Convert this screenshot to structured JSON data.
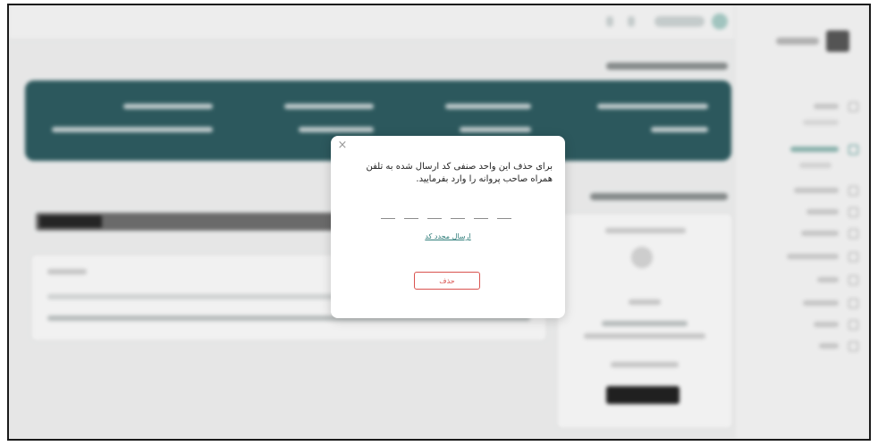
{
  "modal": {
    "close_label": "×",
    "message": "برای حذف این واحد صنفی کد ارسال شده به تلفن همراه صاحب پروانه را وارد بفرمایید.",
    "code_slots": 6,
    "resend_label": "ارسال مجدد کد",
    "delete_label": "حذف"
  },
  "colors": {
    "hero": "#2a5a5f",
    "accent": "#2f7d7a",
    "danger": "#d9534f"
  },
  "icons": [
    "close-icon",
    "otp-digit-slot"
  ]
}
